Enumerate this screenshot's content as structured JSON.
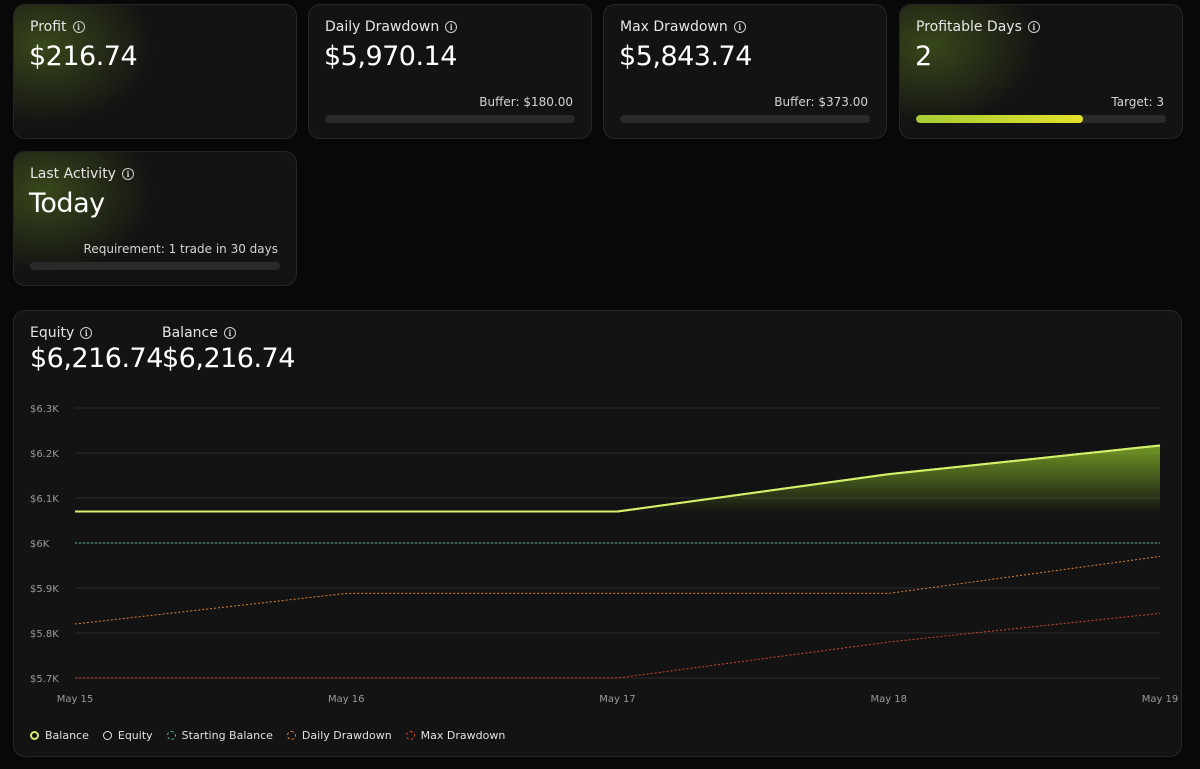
{
  "cards": {
    "profit": {
      "label": "Profit",
      "value": "$216.74"
    },
    "daily_drawdown": {
      "label": "Daily Drawdown",
      "value": "$5,970.14",
      "sub": "Buffer: $180.00",
      "progress": 0
    },
    "max_drawdown": {
      "label": "Max Drawdown",
      "value": "$5,843.74",
      "sub": "Buffer: $373.00",
      "progress": 0
    },
    "profitable_days": {
      "label": "Profitable Days",
      "value": "2",
      "sub": "Target: 3",
      "progress": 0.667
    },
    "last_activity": {
      "label": "Last Activity",
      "value": "Today",
      "sub": "Requirement: 1 trade in 30 days",
      "progress": 0
    }
  },
  "equity": {
    "label": "Equity",
    "value": "$6,216.74"
  },
  "balance": {
    "label": "Balance",
    "value": "$6,216.74"
  },
  "colors": {
    "accent": "#d4f06b",
    "starting_balance": "#4fb89a",
    "daily_drawdown": "#e0822f",
    "max_drawdown": "#d8452e",
    "progress_start": "#a7cc35",
    "progress_end": "#e2e12b"
  },
  "chart_data": {
    "type": "line",
    "x": [
      "May 15",
      "May 16",
      "May 17",
      "May 18",
      "May 19"
    ],
    "yticks": [
      "$6.3K",
      "$6.2K",
      "$6.1K",
      "$6K",
      "$5.9K",
      "$5.8K",
      "$5.7K"
    ],
    "ylim": [
      5700,
      6300
    ],
    "series": [
      {
        "name": "Balance",
        "style": "solid",
        "values": [
          6070,
          6070,
          6070,
          6153,
          6216.74
        ]
      },
      {
        "name": "Equity",
        "style": "solid",
        "values": [
          6070,
          6070,
          6070,
          6153,
          6216.74
        ]
      },
      {
        "name": "Starting Balance",
        "style": "dotted",
        "values": [
          6000,
          6000,
          6000,
          6000,
          6000
        ]
      },
      {
        "name": "Daily Drawdown",
        "style": "dotted",
        "values": [
          5820,
          5888,
          5888,
          5888,
          5970.14
        ]
      },
      {
        "name": "Max Drawdown",
        "style": "dotted",
        "values": [
          5700,
          5700,
          5700,
          5780,
          5843.74
        ]
      }
    ],
    "legend": [
      "Balance",
      "Equity",
      "Starting Balance",
      "Daily Drawdown",
      "Max Drawdown"
    ],
    "legend_position": "bottom-left",
    "grid": true
  }
}
